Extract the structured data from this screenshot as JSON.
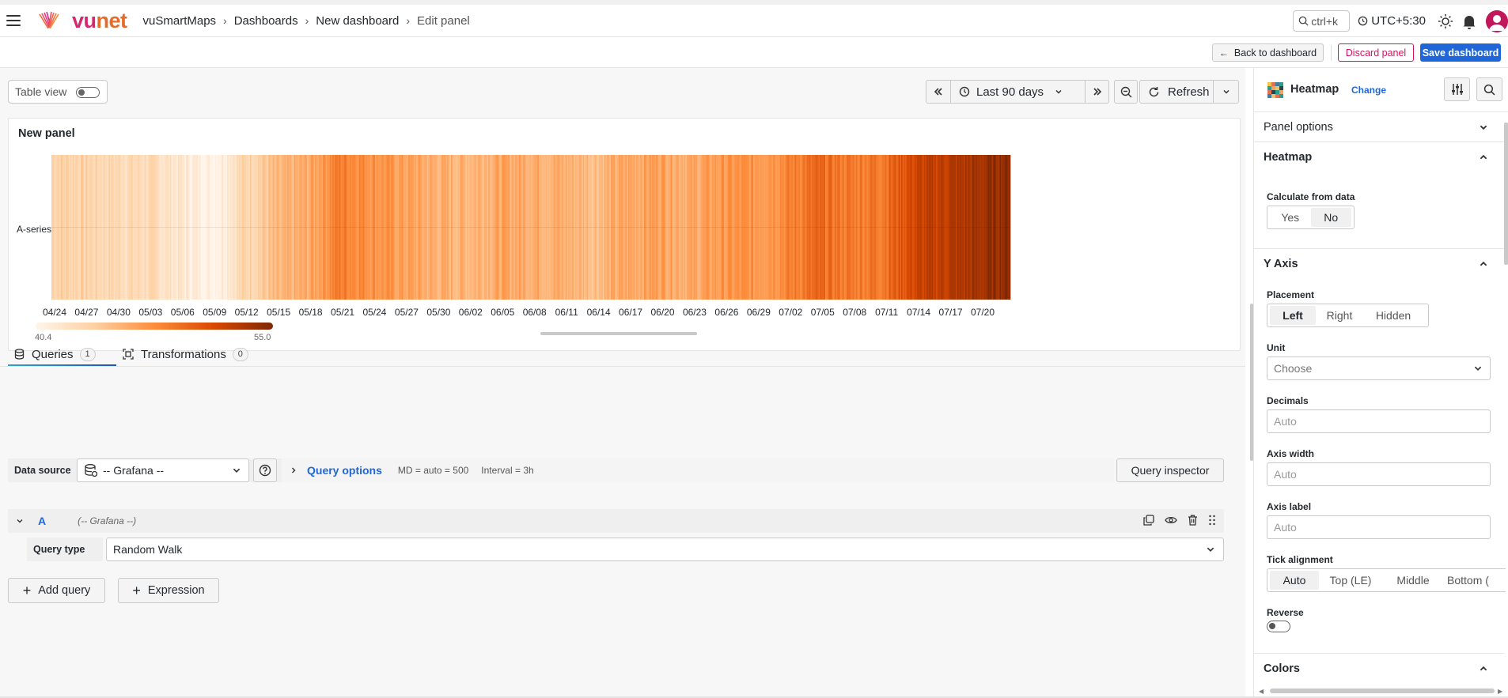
{
  "app": {
    "brand_prefix": "vu",
    "brand_suffix": "net",
    "brand_color": "#d6286f",
    "brand_accent": "#e56b2a"
  },
  "breadcrumb": [
    "vuSmartMaps",
    "Dashboards",
    "New dashboard",
    "Edit panel"
  ],
  "topbar": {
    "search_placeholder": "ctrl+k",
    "timezone": "UTC+5:30",
    "icons": [
      "hamburger-icon",
      "search-icon",
      "clock-icon",
      "sun-icon",
      "bell-icon",
      "avatar"
    ]
  },
  "actions": {
    "back_label": "Back to dashboard",
    "discard_label": "Discard panel",
    "save_label": "Save dashboard",
    "discard_color": "#d4145a",
    "save_color": "#1f66d8"
  },
  "toolbar": {
    "table_view_label": "Table view",
    "table_view_on": false,
    "time_range": "Last 90 days",
    "refresh_label": "Refresh"
  },
  "panel": {
    "title": "New panel",
    "series_label": "A-series",
    "x_ticks": [
      "04/24",
      "04/27",
      "04/30",
      "05/03",
      "05/06",
      "05/09",
      "05/12",
      "05/15",
      "05/18",
      "05/21",
      "05/24",
      "05/27",
      "05/30",
      "06/02",
      "06/05",
      "06/08",
      "06/11",
      "06/14",
      "06/17",
      "06/20",
      "06/23",
      "06/26",
      "06/29",
      "07/02",
      "07/05",
      "07/08",
      "07/11",
      "07/14",
      "07/17",
      "07/20"
    ],
    "legend_min": "40.4",
    "legend_max": "55.0",
    "color_scheme": [
      "#fff5eb",
      "#fdd0a2",
      "#fd8d3c",
      "#d94801",
      "#7f2704"
    ]
  },
  "chart_data": {
    "type": "heatmap",
    "title": "New panel",
    "x": [
      "04/24",
      "04/27",
      "04/30",
      "05/03",
      "05/06",
      "05/09",
      "05/12",
      "05/15",
      "05/18",
      "05/21",
      "05/24",
      "05/27",
      "05/30",
      "06/02",
      "06/05",
      "06/08",
      "06/11",
      "06/14",
      "06/17",
      "06/20",
      "06/23",
      "06/26",
      "06/29",
      "07/02",
      "07/05",
      "07/08",
      "07/11",
      "07/14",
      "07/17",
      "07/20"
    ],
    "y_categories": [
      "A-series"
    ],
    "series": [
      {
        "name": "A-series",
        "values": [
          44.0,
          43.6,
          43.2,
          43.0,
          41.8,
          40.6,
          43.4,
          44.8,
          46.0,
          48.6,
          47.6,
          46.6,
          45.8,
          45.6,
          46.2,
          46.2,
          45.8,
          45.2,
          46.2,
          46.8,
          46.0,
          47.0,
          47.2,
          48.0,
          49.4,
          48.6,
          49.0,
          51.6,
          52.6,
          53.4,
          54.8
        ]
      }
    ],
    "value_range": [
      40.4,
      55.0
    ],
    "legend_min": "40.4",
    "legend_max": "55.0",
    "legend_placement": "bottom-left",
    "grid": true
  },
  "query_tabs": [
    {
      "label": "Queries",
      "count": "1"
    },
    {
      "label": "Transformations",
      "count": "0"
    }
  ],
  "query_editor": {
    "datasource_label": "Data source",
    "datasource_value": "-- Grafana --",
    "query_options_label": "Query options",
    "query_options_meta": "MD = auto = 500",
    "query_options_interval": "Interval = 3h",
    "inspector_label": "Query inspector",
    "query_ref": "A",
    "query_ds_name": "(-- Grafana --)",
    "query_type_label": "Query type",
    "query_type_value": "Random Walk",
    "add_query_label": "Add query",
    "expression_label": "Expression"
  },
  "options": {
    "viz_name": "Heatmap",
    "change_label": "Change",
    "panel_options_label": "Panel options",
    "heatmap_label": "Heatmap",
    "calculate_label": "Calculate from data",
    "calculate_options": [
      "Yes",
      "No"
    ],
    "calculate_selected": "No",
    "yaxis_label": "Y Axis",
    "placement_label": "Placement",
    "placement_options": [
      "Left",
      "Right",
      "Hidden"
    ],
    "placement_selected": "Left",
    "unit_label": "Unit",
    "unit_placeholder": "Choose",
    "decimals_label": "Decimals",
    "decimals_placeholder": "Auto",
    "axis_width_label": "Axis width",
    "axis_width_placeholder": "Auto",
    "axis_label_label": "Axis label",
    "axis_label_placeholder": "Auto",
    "tick_label": "Tick alignment",
    "tick_options": [
      "Auto",
      "Top (LE)",
      "Middle",
      "Bottom ("
    ],
    "tick_selected": "Auto",
    "reverse_label": "Reverse",
    "reverse_on": false,
    "colors_label": "Colors"
  }
}
